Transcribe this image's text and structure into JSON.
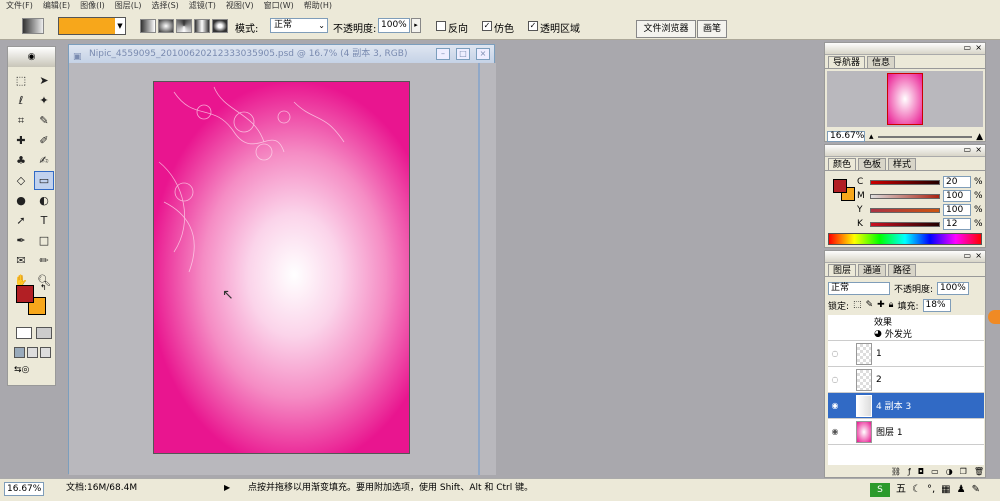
{
  "menu": {
    "items": [
      "文件(F)",
      "编辑(E)",
      "图像(I)",
      "图层(L)",
      "选择(S)",
      "滤镜(T)",
      "视图(V)",
      "窗口(W)",
      "帮助(H)"
    ]
  },
  "options": {
    "mode_label": "模式:",
    "mode_value": "正常",
    "opacity_label": "不透明度:",
    "opacity_value": "100%",
    "reverse_label": "反向",
    "dither_label": "仿色",
    "transparency_label": "透明区域",
    "file_browser_tab": "文件浏览器",
    "brushes_tab": "画笔",
    "gradient_color": "#f7a71b"
  },
  "document": {
    "title": "Nipic_4559095_20100620212333035905.psd @ 16.7% (4 副本 3, RGB)"
  },
  "navigator": {
    "tabs": [
      "导航器",
      "信息"
    ],
    "zoom": "16.67%"
  },
  "color_panel": {
    "tabs": [
      "颜色",
      "色板",
      "样式"
    ],
    "channels": [
      {
        "label": "C",
        "value": "20",
        "unit": "%"
      },
      {
        "label": "M",
        "value": "100",
        "unit": "%"
      },
      {
        "label": "Y",
        "value": "100",
        "unit": "%"
      },
      {
        "label": "K",
        "value": "12",
        "unit": "%"
      }
    ],
    "fg_color": "#b21f24",
    "bg_color": "#f7a71b"
  },
  "layers_panel": {
    "tabs": [
      "图层",
      "通道",
      "路径"
    ],
    "blend_mode": "正常",
    "opacity_label": "不透明度:",
    "opacity_value": "100%",
    "lock_label": "锁定:",
    "fill_label": "填充:",
    "fill_value": "18%",
    "effects_label": "效果",
    "outer_glow_label": "外发光",
    "layers": [
      {
        "name": "1"
      },
      {
        "name": "2"
      },
      {
        "name": "4 副本 3",
        "selected": true
      },
      {
        "name": "图层 1"
      }
    ]
  },
  "status": {
    "zoom": "16.67%",
    "doc_size": "文档:16M/68.4M",
    "hint": "点按并拖移以用渐变填充。要用附加选项，使用 Shift、Alt 和 Ctrl 键。"
  },
  "taskbar": {
    "ime_label": "五"
  }
}
